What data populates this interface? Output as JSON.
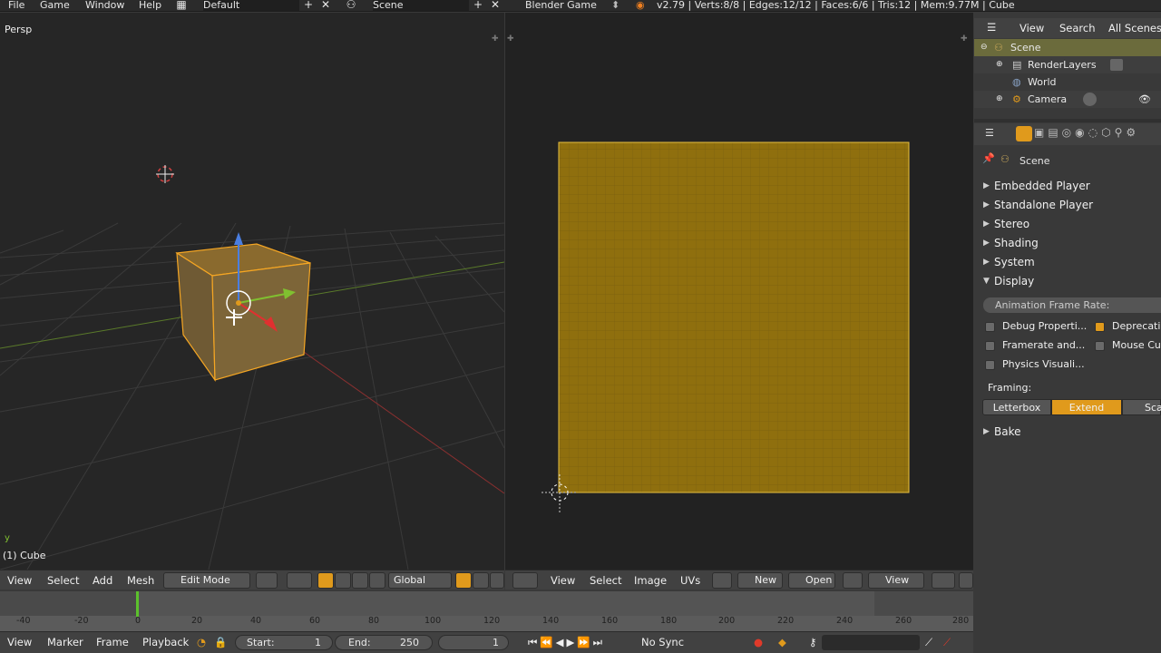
{
  "topbar": {
    "menus": [
      "File",
      "Game",
      "Window",
      "Help"
    ],
    "screen_layout": "Default",
    "scene": "Scene",
    "engine": "Blender Game",
    "stats": "v2.79 | Verts:8/8 | Edges:12/12 | Faces:6/6 | Tris:12 | Mem:9.77M | Cube"
  },
  "viewport3d": {
    "view_label": "Persp",
    "object_label": "(1) Cube",
    "axis_label": "y",
    "header": {
      "menus": [
        "View",
        "Select",
        "Add",
        "Mesh"
      ],
      "mode": "Edit Mode",
      "orientation": "Global"
    }
  },
  "image_editor": {
    "header": {
      "menus": [
        "View",
        "Select",
        "Image",
        "UVs"
      ],
      "new_label": "New",
      "open_label": "Open",
      "view_label": "View"
    }
  },
  "outliner": {
    "header": {
      "view": "View",
      "search": "Search",
      "filter": "All Scenes"
    },
    "items": [
      {
        "label": "Scene",
        "selected": true
      },
      {
        "label": "RenderLayers"
      },
      {
        "label": "World"
      },
      {
        "label": "Camera"
      }
    ]
  },
  "properties": {
    "context": "Scene",
    "panels": [
      {
        "label": "Embedded Player",
        "open": false
      },
      {
        "label": "Standalone Player",
        "open": false
      },
      {
        "label": "Stereo",
        "open": false
      },
      {
        "label": "Shading",
        "open": false
      },
      {
        "label": "System",
        "open": false
      },
      {
        "label": "Display",
        "open": true
      }
    ],
    "display": {
      "frame_rate_label": "Animation Frame Rate:",
      "checkboxes": [
        {
          "label": "Debug Properti...",
          "checked": false
        },
        {
          "label": "Deprecatio",
          "checked": true
        },
        {
          "label": "Framerate and...",
          "checked": false
        },
        {
          "label": "Mouse Cur",
          "checked": false
        },
        {
          "label": "Physics Visuali...",
          "checked": false
        }
      ],
      "framing_label": "Framing:",
      "framing_options": [
        "Letterbox",
        "Extend",
        "Sca"
      ],
      "framing_selected": "Extend"
    },
    "bake_panel": "Bake"
  },
  "timeline": {
    "ticks": [
      "-40",
      "-20",
      "0",
      "20",
      "40",
      "60",
      "80",
      "100",
      "120",
      "140",
      "160",
      "180",
      "200",
      "220",
      "240",
      "260",
      "280"
    ],
    "current_frame": "1",
    "header": {
      "menus": [
        "View",
        "Marker",
        "Frame",
        "Playback"
      ],
      "start_label": "Start:",
      "start_value": "1",
      "end_label": "End:",
      "end_value": "250",
      "frame_value": "1",
      "sync": "No Sync"
    }
  },
  "colors": {
    "accent": "#e09a1c",
    "uv_face": "#8f6f0e",
    "selection_orange": "#f5a623"
  }
}
